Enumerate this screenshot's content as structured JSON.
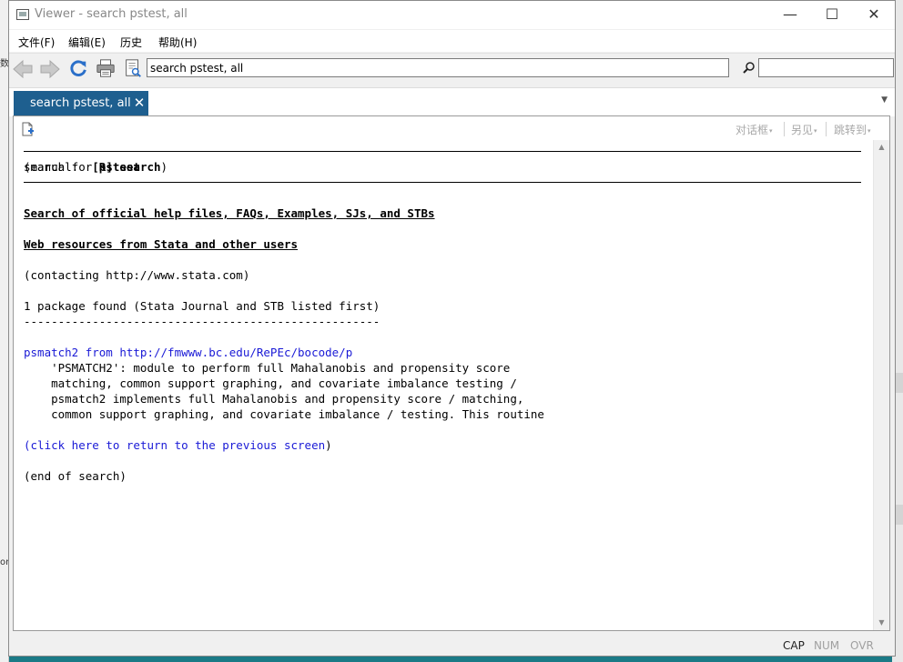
{
  "window": {
    "title": "Viewer - search pstest, all",
    "minimize_glyph": "—",
    "maximize_glyph": "☐",
    "close_glyph": "✕"
  },
  "menu": {
    "items": [
      {
        "label": "文件(F)"
      },
      {
        "label": "编辑(E)"
      },
      {
        "label": "历史"
      },
      {
        "label": "帮助(H)"
      }
    ]
  },
  "toolbar": {
    "icons": [
      "back-arrow-icon",
      "forward-arrow-icon",
      "refresh-icon",
      "print-icon",
      "find-document-icon"
    ],
    "url_value": "search pstest, all",
    "find_value": ""
  },
  "tabs": [
    {
      "label": "search pstest, all",
      "close_glyph": "✕"
    }
  ],
  "tab_dropdown_glyph": "▼",
  "subtoolbar": {
    "dialog_label": "对话框",
    "also_see_label": "另见",
    "jump_to_label": "跳转到",
    "caret": "▾"
  },
  "content": {
    "search_prefix": "search for ",
    "search_term": "pstest",
    "manual_label": "(manual:  ",
    "manual_ref": "[R] search",
    "manual_close": ")",
    "heading_official": "Search of official help files, FAQs, Examples, SJs, and STBs",
    "heading_web": "Web resources from Stata and other users",
    "contacting": "(contacting http://www.stata.com)",
    "found": "1 package found (Stata Journal and STB listed first)",
    "dash_line": "----------------------------------------------------",
    "package_link": "psmatch2 from http://fmwww.bc.edu/RePEc/bocode/p",
    "desc_lines": [
      "    'PSMATCH2': module to perform full Mahalanobis and propensity score",
      "    matching, common support graphing, and covariate imbalance testing /",
      "    psmatch2 implements full Mahalanobis and propensity score / matching,",
      "    common support graphing, and covariate imbalance / testing. This routine"
    ],
    "return_open": "(",
    "return_link": "click here to return to the previous screen",
    "return_close": ")",
    "end": "(end of search)"
  },
  "statusbar": {
    "cap": "CAP",
    "num": "NUM",
    "ovr": "OVR"
  },
  "colors": {
    "tab_active": "#1e5f8f",
    "link": "#1a1ad6",
    "desktop": "#1b7a86"
  }
}
